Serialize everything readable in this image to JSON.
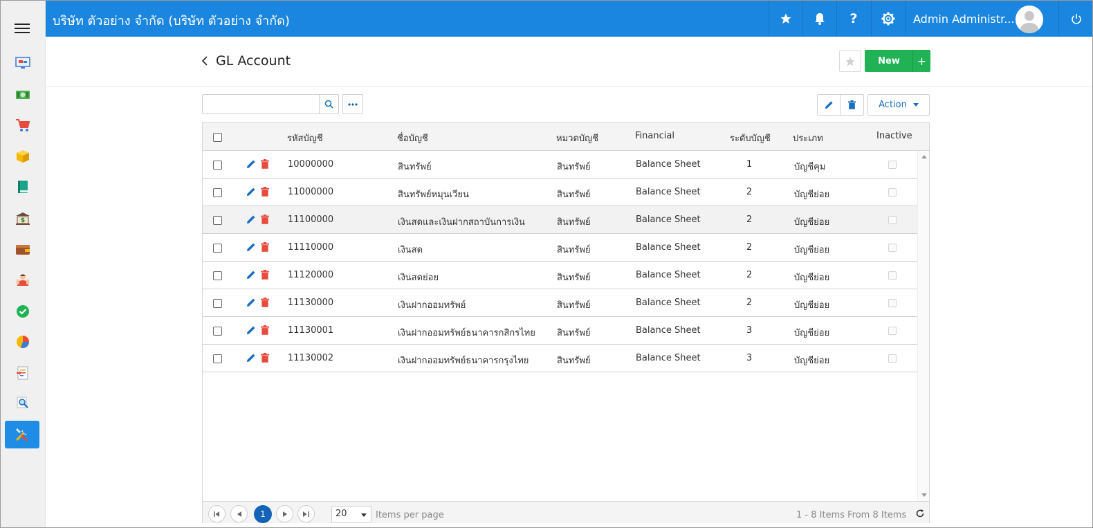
{
  "header": {
    "company": "บริษัท ตัวอย่าง จำกัด (บริษัท ตัวอย่าง จำกัด)",
    "user_name": "Admin Administr...",
    "accent": "#1a86e0"
  },
  "page": {
    "title": "GL Account",
    "new_label": "New",
    "plus_label": "+"
  },
  "toolbar": {
    "search_placeholder": "",
    "action_label": "Action"
  },
  "grid": {
    "columns": [
      "รหัสบัญชี",
      "ชื่อบัญชี",
      "หมวดบัญชี",
      "Financial",
      "ระดับบัญชี",
      "ประเภท",
      "Inactive"
    ],
    "rows": [
      {
        "code": "10000000",
        "name": "สินทรัพย์",
        "category": "สินทรัพย์",
        "financial": "Balance Sheet",
        "level": "1",
        "type": "บัญชีคุม"
      },
      {
        "code": "11000000",
        "name": "สินทรัพย์หมุนเวียน",
        "category": "สินทรัพย์",
        "financial": "Balance Sheet",
        "level": "2",
        "type": "บัญชีย่อย"
      },
      {
        "code": "11100000",
        "name": "เงินสดและเงินฝากสถาบันการเงิน",
        "category": "สินทรัพย์",
        "financial": "Balance Sheet",
        "level": "2",
        "type": "บัญชีย่อย"
      },
      {
        "code": "11110000",
        "name": "เงินสด",
        "category": "สินทรัพย์",
        "financial": "Balance Sheet",
        "level": "2",
        "type": "บัญชีย่อย"
      },
      {
        "code": "11120000",
        "name": "เงินสดย่อย",
        "category": "สินทรัพย์",
        "financial": "Balance Sheet",
        "level": "2",
        "type": "บัญชีย่อย"
      },
      {
        "code": "11130000",
        "name": "เงินฝากออมทรัพย์",
        "category": "สินทรัพย์",
        "financial": "Balance Sheet",
        "level": "2",
        "type": "บัญชีย่อย"
      },
      {
        "code": "11130001",
        "name": "เงินฝากออมทรัพย์ธนาคารกสิกรไทย",
        "category": "สินทรัพย์",
        "financial": "Balance Sheet",
        "level": "3",
        "type": "บัญชีย่อย"
      },
      {
        "code": "11130002",
        "name": "เงินฝากออมทรัพย์ธนาคารกรุงไทย",
        "category": "สินทรัพย์",
        "financial": "Balance Sheet",
        "level": "3",
        "type": "บัญชีย่อย"
      }
    ]
  },
  "pager": {
    "current_page": "1",
    "page_size": "20",
    "items_per_page_label": "Items per page",
    "info": "1 - 8 Items From 8 Items"
  },
  "sidebar": {
    "icons": [
      "dashboard-icon",
      "money-icon",
      "cart-icon",
      "box-icon",
      "book-icon",
      "bank-icon",
      "wallet-icon",
      "people-icon",
      "check-icon",
      "pie-chart-icon",
      "report-icon",
      "search-doc-icon",
      "settings-tools-icon"
    ]
  }
}
